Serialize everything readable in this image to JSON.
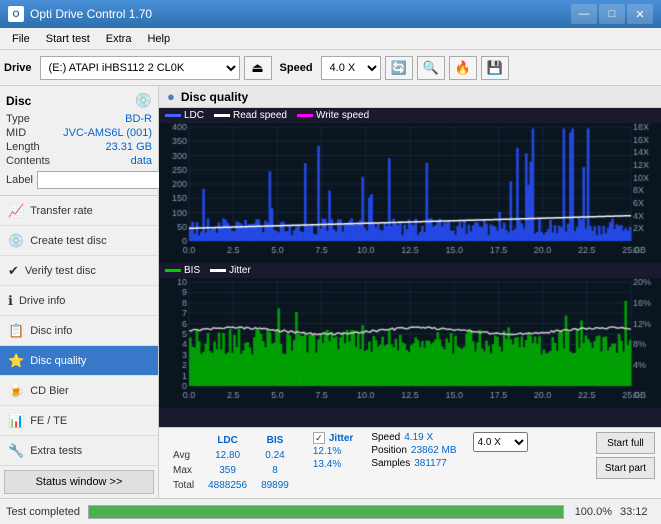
{
  "titleBar": {
    "title": "Opti Drive Control 1.70",
    "minBtn": "—",
    "maxBtn": "□",
    "closeBtn": "✕"
  },
  "menuBar": {
    "items": [
      "File",
      "Start test",
      "Extra",
      "Help"
    ]
  },
  "toolbar": {
    "driveLabel": "Drive",
    "driveValue": "(E:) ATAPI iHBS112  2 CL0K",
    "speedLabel": "Speed",
    "speedValue": "4.0 X"
  },
  "disc": {
    "title": "Disc",
    "typeLabel": "Type",
    "typeValue": "BD-R",
    "midLabel": "MID",
    "midValue": "JVC-AMS6L (001)",
    "lengthLabel": "Length",
    "lengthValue": "23.31 GB",
    "contentsLabel": "Contents",
    "contentsValue": "data",
    "labelLabel": "Label",
    "labelValue": ""
  },
  "nav": {
    "items": [
      {
        "id": "transfer-rate",
        "label": "Transfer rate",
        "icon": "📈"
      },
      {
        "id": "create-test",
        "label": "Create test disc",
        "icon": "💿"
      },
      {
        "id": "verify-test",
        "label": "Verify test disc",
        "icon": "✔"
      },
      {
        "id": "drive-info",
        "label": "Drive info",
        "icon": "ℹ"
      },
      {
        "id": "disc-info",
        "label": "Disc info",
        "icon": "📋"
      },
      {
        "id": "disc-quality",
        "label": "Disc quality",
        "icon": "⭐",
        "active": true
      },
      {
        "id": "cd-bier",
        "label": "CD Bier",
        "icon": "🍺"
      },
      {
        "id": "fe-te",
        "label": "FE / TE",
        "icon": "📊"
      },
      {
        "id": "extra-tests",
        "label": "Extra tests",
        "icon": "🔧"
      }
    ],
    "statusBtn": "Status window >>"
  },
  "chartHeader": {
    "title": "Disc quality",
    "icon": "●"
  },
  "legend1": {
    "items": [
      {
        "label": "LDC",
        "color": "#0000ff"
      },
      {
        "label": "Read speed",
        "color": "#ffffff"
      },
      {
        "label": "Write speed",
        "color": "#ff00ff"
      }
    ]
  },
  "legend2": {
    "items": [
      {
        "label": "BIS",
        "color": "#00cc00"
      },
      {
        "label": "Jitter",
        "color": "#ffffff"
      }
    ]
  },
  "stats": {
    "headers": [
      "LDC",
      "BIS",
      "",
      "Jitter",
      "Speed",
      "4.19 X",
      "",
      "4.0 X"
    ],
    "rows": [
      {
        "label": "Avg",
        "ldc": "12.80",
        "bis": "0.24",
        "jitter": "12.1%"
      },
      {
        "label": "Max",
        "ldc": "359",
        "bis": "8",
        "jitter": "13.4%"
      },
      {
        "label": "Total",
        "ldc": "4888256",
        "bis": "89899",
        "jitter": ""
      }
    ],
    "position": {
      "label": "Position",
      "value": "23862 MB"
    },
    "samples": {
      "label": "Samples",
      "value": "381177"
    },
    "jitterLabel": "Jitter",
    "startFull": "Start full",
    "startPart": "Start part"
  },
  "statusBar": {
    "text": "Test completed",
    "progress": 100,
    "progressLabel": "100.0%",
    "time": "33:12"
  },
  "charts": {
    "chart1": {
      "yMax": 400,
      "yMin": 0,
      "xMax": 25,
      "rightAxisMax": 18,
      "label": "LDC/Speed"
    },
    "chart2": {
      "yMax": 10,
      "yMin": 0,
      "xMax": 25,
      "rightAxisMax": 20,
      "label": "BIS/Jitter"
    }
  }
}
